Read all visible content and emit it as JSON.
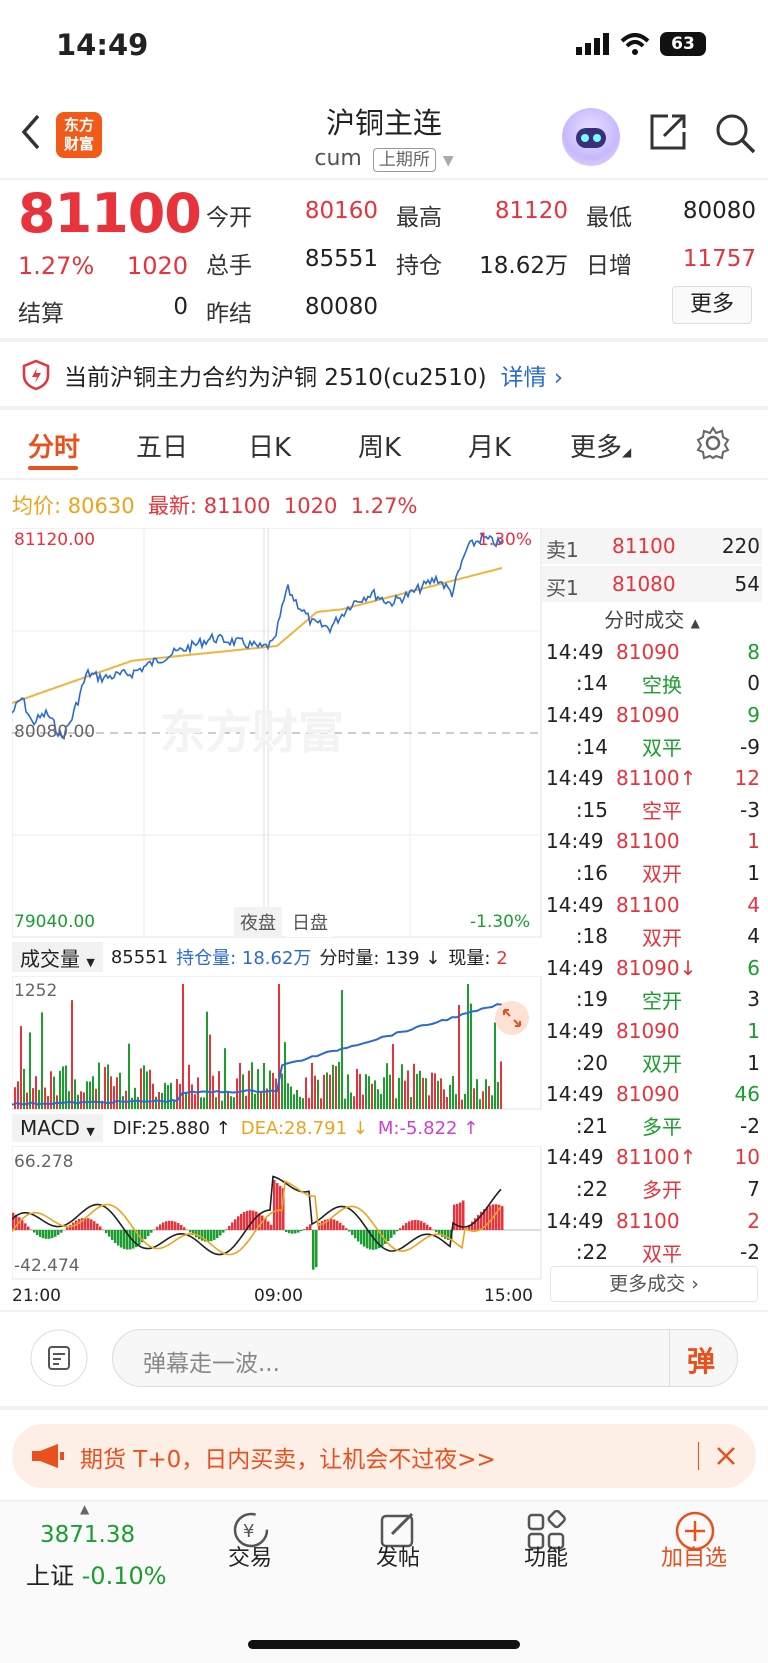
{
  "status_bar": {
    "time": "14:49",
    "battery": "63"
  },
  "header": {
    "title": "沪铜主连",
    "code": "cum",
    "exchange": "上期所",
    "logo_line1": "东方",
    "logo_line2": "财富"
  },
  "quote": {
    "price": "81100",
    "change_pct": "1.27%",
    "change": "1020",
    "fields": [
      {
        "label": "今开",
        "value": "80160"
      },
      {
        "label": "最高",
        "value": "81120"
      },
      {
        "label": "最低",
        "value": "80080"
      },
      {
        "label": "总手",
        "value": "85551"
      },
      {
        "label": "持仓",
        "value": "18.62万"
      },
      {
        "label": "日增",
        "value": "11757"
      },
      {
        "label": "结算",
        "value": "0"
      },
      {
        "label": "昨结",
        "value": "80080"
      }
    ],
    "more_label": "更多"
  },
  "notice": {
    "text": "当前沪铜主力合约为沪铜 2510(cu2510)",
    "link": "详情"
  },
  "tabs": [
    "分时",
    "五日",
    "日K",
    "周K",
    "月K",
    "更多"
  ],
  "info_line": {
    "avg_label": "均价:",
    "avg_value": "80630",
    "latest_label": "最新:",
    "latest_value": "81100",
    "change": "1020",
    "pct": "1.27%"
  },
  "chart": {
    "y_high": "81120.00",
    "y_low": "79040.00",
    "pct_high": "1.30%",
    "pct_low": "-1.30%",
    "ref_price": "80080.00",
    "session_night": "夜盘",
    "session_day": "日盘",
    "watermark": "东方财富",
    "time_ticks": [
      "21:00",
      "09:00",
      "15:00"
    ]
  },
  "volume_bar": {
    "selector": "成交量",
    "total": "85551",
    "oi_label": "持仓量:",
    "oi_value": "18.62万",
    "min_vol_label": "分时量:",
    "min_vol": "139",
    "cur_label": "现量:",
    "cur_value": "2",
    "ymax": "1252"
  },
  "macd_bar": {
    "selector": "MACD",
    "dif": "DIF:25.880",
    "dea": "DEA:28.791",
    "m": "M:-5.822",
    "ymax": "66.278",
    "ymin": "-42.474"
  },
  "order_book": {
    "ask": {
      "label": "卖1",
      "price": "81100",
      "vol": "220"
    },
    "bid": {
      "label": "买1",
      "price": "81080",
      "vol": "54"
    },
    "ticks_title": "分时成交",
    "ticks": [
      {
        "t": "14:49",
        "v1": "81090",
        "v2": "8",
        "c": "red",
        "c2": "green"
      },
      {
        "t": ":14",
        "v1": "空换",
        "v2": "0",
        "c": "green",
        "c2": "dark"
      },
      {
        "t": "14:49",
        "v1": "81090",
        "v2": "9",
        "c": "red",
        "c2": "green"
      },
      {
        "t": ":14",
        "v1": "双平",
        "v2": "-9",
        "c": "green",
        "c2": "dark"
      },
      {
        "t": "14:49",
        "v1": "81100↑",
        "v2": "12",
        "c": "red",
        "c2": "red"
      },
      {
        "t": ":15",
        "v1": "空平",
        "v2": "-3",
        "c": "red",
        "c2": "dark"
      },
      {
        "t": "14:49",
        "v1": "81100",
        "v2": "1",
        "c": "red",
        "c2": "red"
      },
      {
        "t": ":16",
        "v1": "双开",
        "v2": "1",
        "c": "red",
        "c2": "dark"
      },
      {
        "t": "14:49",
        "v1": "81100",
        "v2": "4",
        "c": "red",
        "c2": "red"
      },
      {
        "t": ":18",
        "v1": "双开",
        "v2": "4",
        "c": "red",
        "c2": "dark"
      },
      {
        "t": "14:49",
        "v1": "81090↓",
        "v2": "6",
        "c": "red",
        "c2": "green"
      },
      {
        "t": ":19",
        "v1": "空开",
        "v2": "3",
        "c": "green",
        "c2": "dark"
      },
      {
        "t": "14:49",
        "v1": "81090",
        "v2": "1",
        "c": "red",
        "c2": "green"
      },
      {
        "t": ":20",
        "v1": "双开",
        "v2": "1",
        "c": "green",
        "c2": "dark"
      },
      {
        "t": "14:49",
        "v1": "81090",
        "v2": "46",
        "c": "red",
        "c2": "green"
      },
      {
        "t": ":21",
        "v1": "多平",
        "v2": "-2",
        "c": "green",
        "c2": "dark"
      },
      {
        "t": "14:49",
        "v1": "81100↑",
        "v2": "10",
        "c": "red",
        "c2": "red"
      },
      {
        "t": ":22",
        "v1": "多开",
        "v2": "7",
        "c": "red",
        "c2": "dark"
      },
      {
        "t": "14:49",
        "v1": "81100",
        "v2": "2",
        "c": "red",
        "c2": "red"
      },
      {
        "t": ":22",
        "v1": "双平",
        "v2": "-2",
        "c": "red",
        "c2": "dark"
      }
    ],
    "more_ticks": "更多成交"
  },
  "danmu": {
    "placeholder": "弹幕走一波...",
    "btn": "弹"
  },
  "promo": {
    "text": "期货 T+0，日内买卖，让机会不过夜>>"
  },
  "bottom_nav": {
    "index_value": "3871.38",
    "index_name": "上证",
    "index_change": "-0.10%",
    "items": [
      "交易",
      "发帖",
      "功能",
      "加自选"
    ]
  },
  "colors": {
    "up": "#e8323c",
    "down": "#1a9e2e",
    "price_line": "#2a6ad3",
    "avg_line": "#f0b43c",
    "accent": "#e8501e"
  }
}
